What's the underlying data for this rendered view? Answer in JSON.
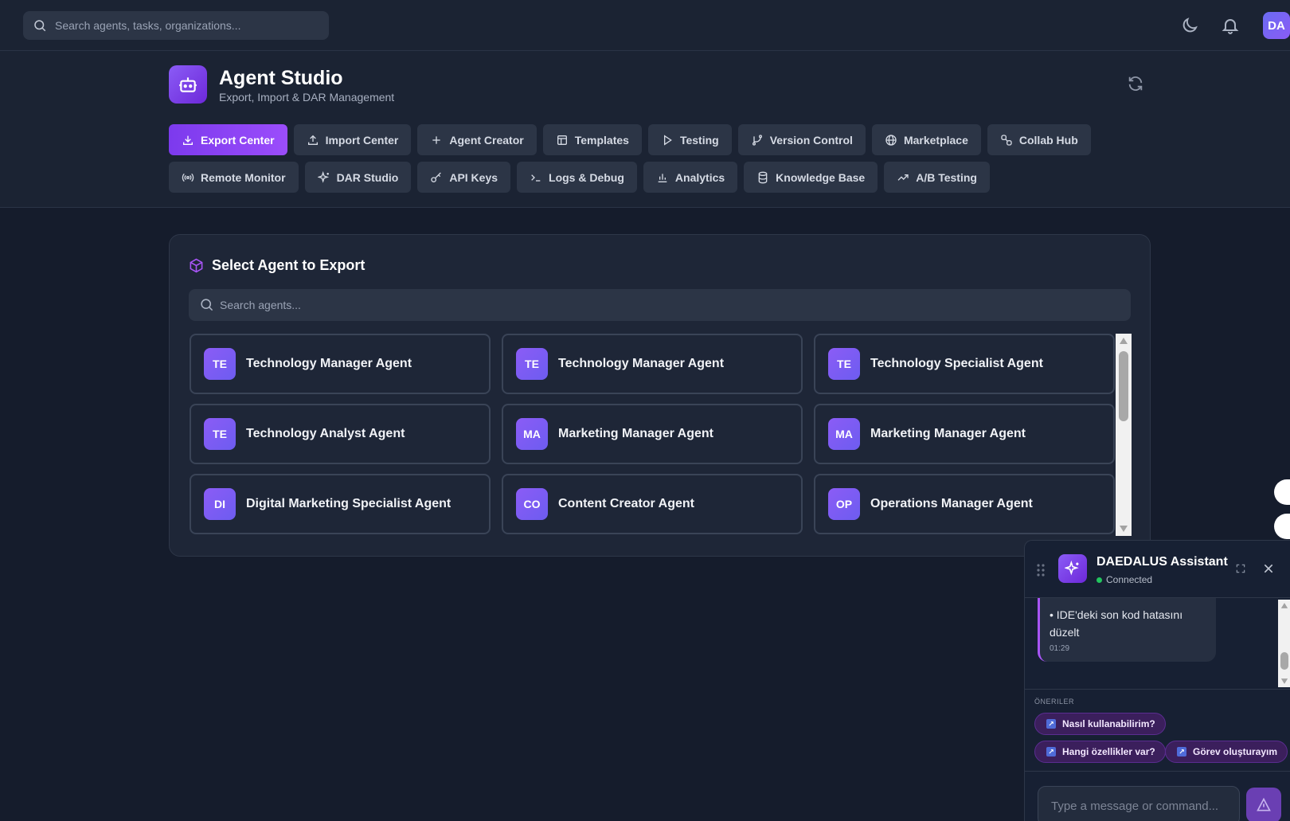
{
  "topbar": {
    "search_placeholder": "Search agents, tasks, organizations...",
    "avatar_initials": "DA"
  },
  "header": {
    "title": "Agent Studio",
    "subtitle": "Export, Import & DAR Management"
  },
  "tabs": {
    "row1": [
      {
        "label": "Export Center",
        "icon": "download-icon",
        "active": true
      },
      {
        "label": "Import Center",
        "icon": "upload-icon"
      },
      {
        "label": "Agent Creator",
        "icon": "plus-icon"
      },
      {
        "label": "Templates",
        "icon": "layout-icon"
      },
      {
        "label": "Testing",
        "icon": "play-icon"
      },
      {
        "label": "Version Control",
        "icon": "git-branch-icon"
      },
      {
        "label": "Marketplace",
        "icon": "globe-icon"
      },
      {
        "label": "Collab Hub",
        "icon": "link-icon"
      }
    ],
    "row2": [
      {
        "label": "Remote Monitor",
        "icon": "broadcast-icon"
      },
      {
        "label": "DAR Studio",
        "icon": "sparkles-icon"
      },
      {
        "label": "API Keys",
        "icon": "key-icon"
      },
      {
        "label": "Logs & Debug",
        "icon": "terminal-icon"
      },
      {
        "label": "Analytics",
        "icon": "bar-chart-icon"
      },
      {
        "label": "Knowledge Base",
        "icon": "database-icon"
      },
      {
        "label": "A/B Testing",
        "icon": "trending-up-icon"
      }
    ]
  },
  "panel": {
    "title": "Select Agent to Export",
    "search_placeholder": "Search agents...",
    "agents": [
      {
        "initials": "TE",
        "name": "Technology Manager Agent"
      },
      {
        "initials": "TE",
        "name": "Technology Manager Agent"
      },
      {
        "initials": "TE",
        "name": "Technology Specialist Agent"
      },
      {
        "initials": "TE",
        "name": "Technology Analyst Agent"
      },
      {
        "initials": "MA",
        "name": "Marketing Manager Agent"
      },
      {
        "initials": "MA",
        "name": "Marketing Manager Agent"
      },
      {
        "initials": "DI",
        "name": "Digital Marketing Specialist Agent"
      },
      {
        "initials": "CO",
        "name": "Content Creator Agent"
      },
      {
        "initials": "OP",
        "name": "Operations Manager Agent"
      }
    ]
  },
  "chat": {
    "title": "DAEDALUS Assistant",
    "status": "Connected",
    "message_text": "• IDE'deki son kod hatasını düzelt",
    "message_time": "01:29",
    "suggestions_label": "ÖNERILER",
    "suggestions": [
      "Nasıl kullanabilirim?",
      "Hangi özellikler var?",
      "Görev oluşturayım"
    ],
    "input_placeholder": "Type a message or command..."
  },
  "colors": {
    "accent": "#7c3aed",
    "background": "#151c2c",
    "surface": "#1e2637",
    "status_ok": "#22c55e"
  }
}
